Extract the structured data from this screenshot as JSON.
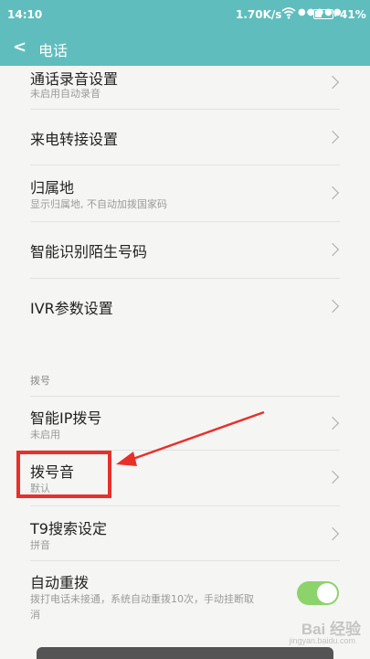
{
  "status_bar": {
    "time": "14:10",
    "net_speed": "1.70K/s",
    "signal": "●●●●●",
    "battery_percent": "41%",
    "battery_level": 0.41
  },
  "app_bar": {
    "title": "电话"
  },
  "settings": [
    {
      "title": "通话录音设置",
      "subtitle": "未启用自动录音"
    },
    {
      "title": "来电转接设置"
    },
    {
      "title": "归属地",
      "subtitle": "显示归属地, 不自动加拨国家码"
    },
    {
      "title": "智能识别陌生号码"
    },
    {
      "title": "IVR参数设置"
    }
  ],
  "section_dial": {
    "label": "拨号",
    "items": [
      {
        "title": "智能IP拨号",
        "subtitle": "未启用"
      },
      {
        "title": "拨号音",
        "subtitle": "默认"
      },
      {
        "title": "T9搜索设定",
        "subtitle": "拼音"
      },
      {
        "title": "自动重拨",
        "subtitle_line1": "拨打电话未接通，系统自动重拨10次，手动挂断取",
        "subtitle_line2": "消",
        "enabled": true
      }
    ]
  },
  "watermark": {
    "main": "Bai 经验",
    "sub": "jingyan.baidu.com"
  }
}
